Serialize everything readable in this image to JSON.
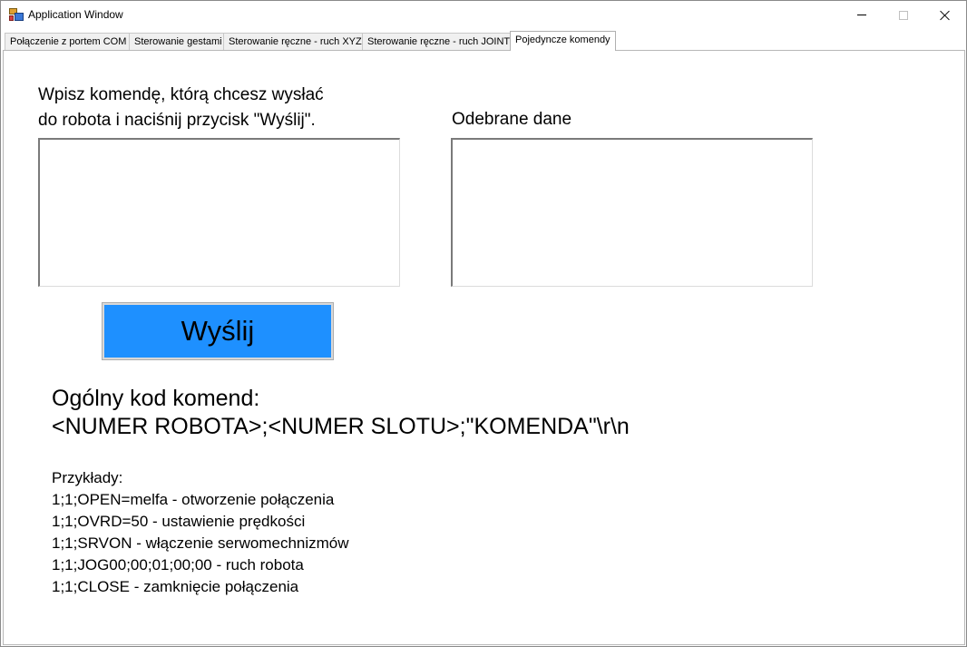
{
  "window": {
    "title": "Application Window"
  },
  "tabs": [
    {
      "label": "Połączenie z portem COM",
      "active": false
    },
    {
      "label": "Sterowanie gestami",
      "active": false
    },
    {
      "label": "Sterowanie ręczne - ruch XYZ",
      "active": false
    },
    {
      "label": "Sterowanie ręczne - ruch JOINT",
      "active": false
    },
    {
      "label": "Pojedyncze komendy",
      "active": true
    }
  ],
  "commands": {
    "prompt": "Wpisz komendę, którą chcesz wysłać\ndo robota i naciśnij przycisk \"Wyślij\".",
    "input_value": "",
    "received_label": "Odebrane dane",
    "received_value": "",
    "send_label": "Wyślij",
    "send_color": "#1e90ff",
    "code_title": "Ogólny kod komend:",
    "code_format": "<NUMER ROBOTA>;<NUMER SLOTU>;\"KOMENDA\"\\r\\n",
    "examples_title": "Przykłady:",
    "examples": [
      "1;1;OPEN=melfa - otworzenie połączenia",
      "1;1;OVRD=50 - ustawienie prędkości",
      "1;1;SRVON - włączenie serwomechnizmów",
      "1;1;JOG00;00;01;00;00 - ruch robota",
      "1;1;CLOSE - zamknięcie połączenia"
    ]
  }
}
